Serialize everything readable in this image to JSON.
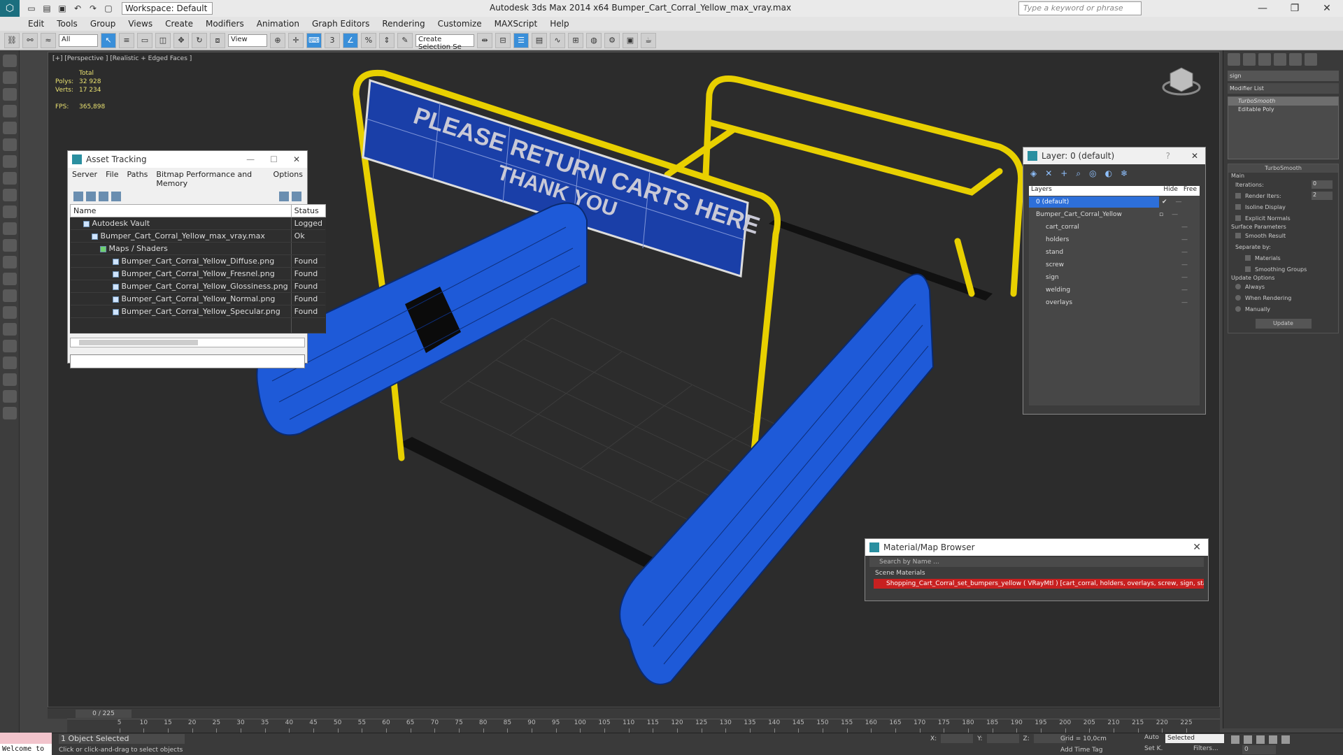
{
  "window": {
    "app_title": "Autodesk 3ds Max  2014 x64     Bumper_Cart_Corral_Yellow_max_vray.max",
    "workspace": "Workspace: Default",
    "search_placeholder": "Type a keyword or phrase"
  },
  "menu": [
    "Edit",
    "Tools",
    "Group",
    "Views",
    "Create",
    "Modifiers",
    "Animation",
    "Graph Editors",
    "Rendering",
    "Customize",
    "MAXScript",
    "Help"
  ],
  "toolbar": {
    "filter_dropdown": "All",
    "refcoord_dropdown": "View",
    "selection_set": "Create Selection Se"
  },
  "viewport": {
    "label": "[+] [Perspective ] [Realistic + Edged Faces ]",
    "stats": {
      "total_label": "Total",
      "polys_label": "Polys:",
      "polys": "32 928",
      "verts_label": "Verts:",
      "verts": "17 234",
      "fps_label": "FPS:",
      "fps": "365,898"
    },
    "sign_line1": "PLEASE RETURN CARTS HERE",
    "sign_line2": "THANK YOU"
  },
  "asset_tracking": {
    "title": "Asset Tracking",
    "menu": [
      "Server",
      "File",
      "Paths",
      "Bitmap Performance and Memory",
      "Options"
    ],
    "col_name": "Name",
    "col_status": "Status",
    "rows": [
      {
        "name": "Autodesk Vault",
        "status": "Logged",
        "indent": 0
      },
      {
        "name": "Bumper_Cart_Corral_Yellow_max_vray.max",
        "status": "Ok",
        "indent": 1
      },
      {
        "name": "Maps / Shaders",
        "status": "",
        "indent": 2
      },
      {
        "name": "Bumper_Cart_Corral_Yellow_Diffuse.png",
        "status": "Found",
        "indent": 3
      },
      {
        "name": "Bumper_Cart_Corral_Yellow_Fresnel.png",
        "status": "Found",
        "indent": 3
      },
      {
        "name": "Bumper_Cart_Corral_Yellow_Glossiness.png",
        "status": "Found",
        "indent": 3
      },
      {
        "name": "Bumper_Cart_Corral_Yellow_Normal.png",
        "status": "Found",
        "indent": 3
      },
      {
        "name": "Bumper_Cart_Corral_Yellow_Specular.png",
        "status": "Found",
        "indent": 3
      }
    ]
  },
  "layer_window": {
    "title": "Layer: 0 (default)",
    "col_layers": "Layers",
    "col_hide": "Hide",
    "col_freeze": "Free",
    "rows": [
      {
        "name": "0 (default)",
        "indent": 0,
        "selected": true
      },
      {
        "name": "Bumper_Cart_Corral_Yellow",
        "indent": 0,
        "selected": false
      },
      {
        "name": "cart_corral",
        "indent": 1,
        "selected": false
      },
      {
        "name": "holders",
        "indent": 1,
        "selected": false
      },
      {
        "name": "stand",
        "indent": 1,
        "selected": false
      },
      {
        "name": "screw",
        "indent": 1,
        "selected": false
      },
      {
        "name": "sign",
        "indent": 1,
        "selected": false
      },
      {
        "name": "welding",
        "indent": 1,
        "selected": false
      },
      {
        "name": "overlays",
        "indent": 1,
        "selected": false
      }
    ]
  },
  "material_browser": {
    "title": "Material/Map Browser",
    "search_placeholder": "Search by Name ...",
    "section": "Scene Materials",
    "item": "Shopping_Cart_Corral_set_bumpers_yellow ( VRayMtl ) [cart_corral, holders, overlays, screw, sign, stand, welding]"
  },
  "command_panel": {
    "object_name": "sign",
    "modifier_list": "Modifier List",
    "stack": [
      "TurboSmooth",
      "Editable Poly"
    ],
    "turbosmooth_title": "TurboSmooth",
    "main_label": "Main",
    "iterations_label": "Iterations:",
    "iterations": "0",
    "render_iters_label": "Render Iters:",
    "render_iters": "2",
    "isoline": "Isoline Display",
    "explicit_normals": "Explicit Normals",
    "surface_params": "Surface Parameters",
    "smooth_result": "Smooth Result",
    "separate_by": "Separate by:",
    "materials": "Materials",
    "smoothing_groups": "Smoothing Groups",
    "update_options": "Update Options",
    "always": "Always",
    "when_rendering": "When Rendering",
    "manually": "Manually",
    "update_button": "Update"
  },
  "timeline": {
    "frame_slider": "0 / 225",
    "ticks": [
      "5",
      "10",
      "15",
      "20",
      "25",
      "30",
      "35",
      "40",
      "45",
      "50",
      "55",
      "60",
      "65",
      "70",
      "75",
      "80",
      "85",
      "90",
      "95",
      "100",
      "105",
      "110",
      "115",
      "120",
      "125",
      "130",
      "135",
      "140",
      "145",
      "150",
      "155",
      "160",
      "165",
      "170",
      "175",
      "180",
      "185",
      "190",
      "195",
      "200",
      "205",
      "210",
      "215",
      "220",
      "225"
    ]
  },
  "status": {
    "welcome": "Welcome to",
    "selection": "1 Object Selected",
    "prompt": "Click or click-and-drag to select objects",
    "x_label": "X:",
    "y_label": "Y:",
    "z_label": "Z:",
    "grid": "Grid = 10,0cm",
    "add_time_tag": "Add Time Tag",
    "auto": "Auto",
    "selected": "Selected",
    "set_key": "Set K.",
    "filters": "Filters...",
    "frame": "0"
  }
}
